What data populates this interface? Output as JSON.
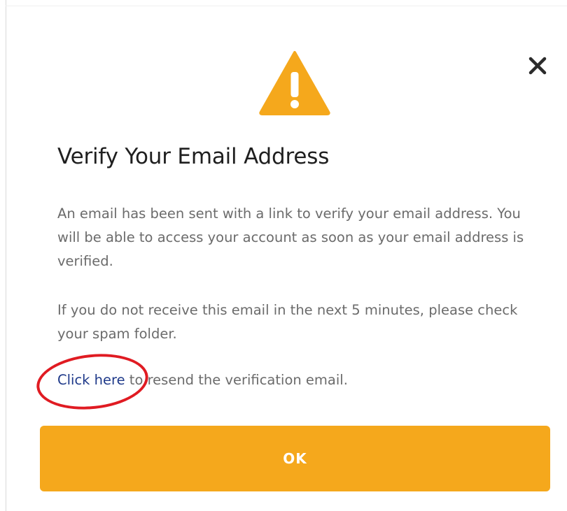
{
  "dialog": {
    "title": "Verify Your Email Address",
    "paragraph_1": "An email has been sent with a link to verify your email address. You will be able to access your account as soon as your email address is verified.",
    "paragraph_2": "If you do not receive this email in the next 5 minutes, please check your spam folder.",
    "resend": {
      "link_text": "Click here",
      "after_text": " to resend the verification email."
    },
    "ok_label": "OK",
    "close_icon": "close-icon",
    "warning_icon": "warning-triangle-icon"
  },
  "colors": {
    "accent": "#f5a81c",
    "link": "#1f3a8a",
    "annotation": "#e01b22",
    "title_text": "#1f1f1f",
    "body_text": "#6b6b6b"
  }
}
